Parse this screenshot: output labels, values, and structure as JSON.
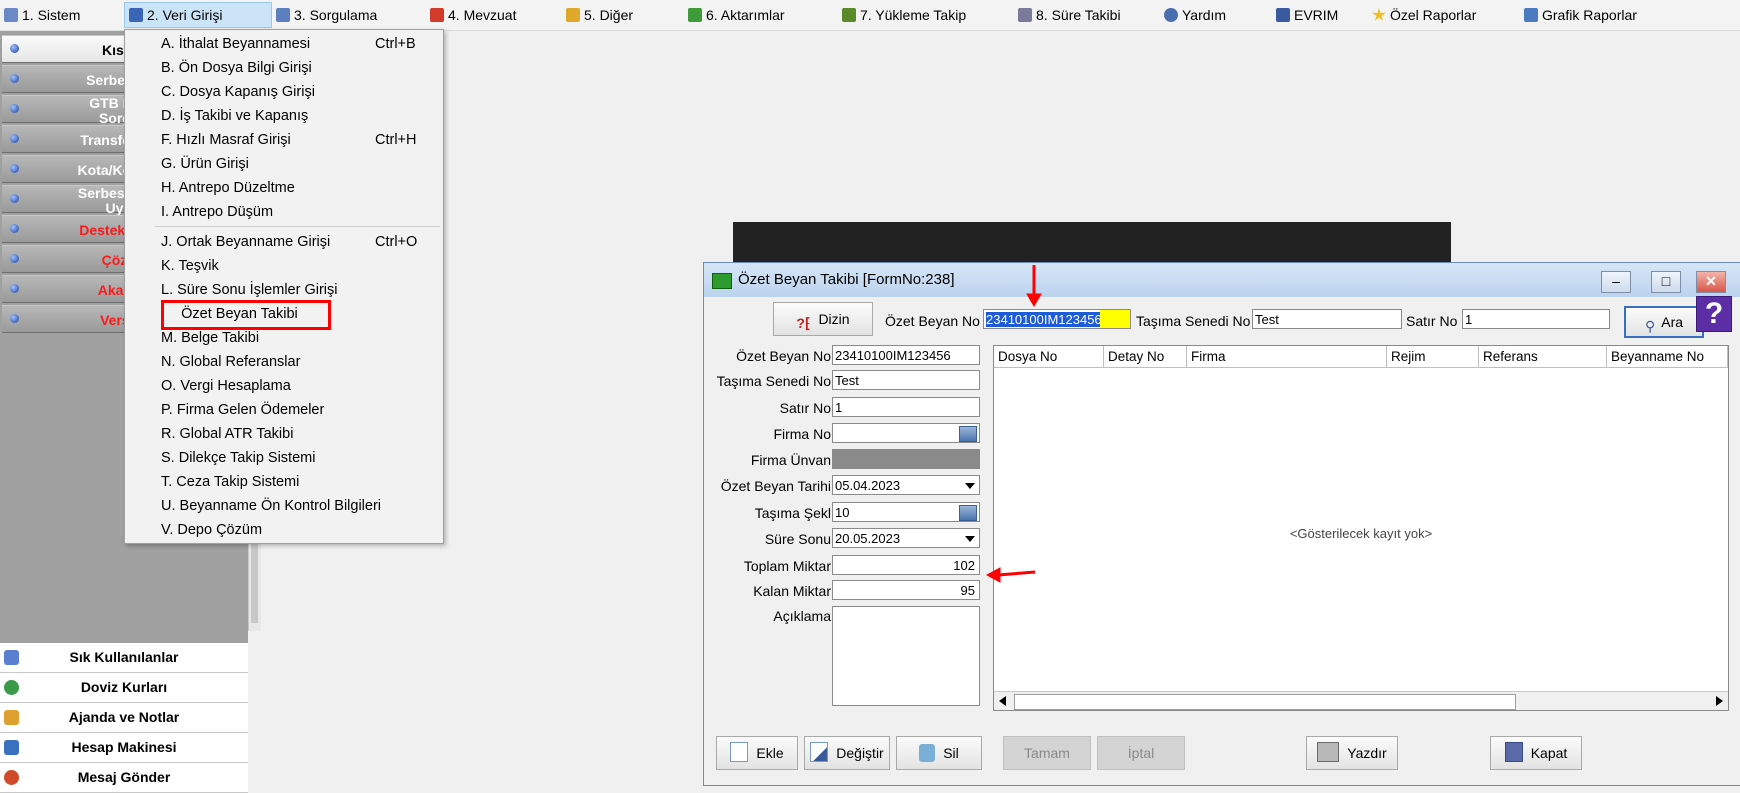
{
  "menubar": {
    "items": [
      {
        "label": "1.  Sistem"
      },
      {
        "label": "2.  Veri Girişi"
      },
      {
        "label": "3.  Sorgulama"
      },
      {
        "label": "4.  Mevzuat"
      },
      {
        "label": "5.  Diğer"
      },
      {
        "label": "6.  Aktarımlar"
      },
      {
        "label": "7.  Yükleme Takip"
      },
      {
        "label": "8. Süre Takibi"
      },
      {
        "label": "Yardım"
      },
      {
        "label": "EVRIM"
      },
      {
        "label": "Özel Raporlar"
      },
      {
        "label": "Grafik Raporlar"
      }
    ]
  },
  "sidebar": {
    "items": [
      {
        "label": "Kısayo"
      },
      {
        "label": "Serbest Böl"
      },
      {
        "label": "GTB DIR B\nSorgula"
      },
      {
        "label": "Transfer Bildi"
      },
      {
        "label": "Kota/Kontenja"
      },
      {
        "label": "Serbest Bölge\nUygul"
      },
      {
        "label": "Destek Videol"
      },
      {
        "label": "Çözüm"
      },
      {
        "label": "Akadem"
      },
      {
        "label": "Versiyo"
      }
    ],
    "bottom": [
      {
        "label": "Sık Kullanılanlar"
      },
      {
        "label": "Doviz Kurları"
      },
      {
        "label": "Ajanda ve Notlar"
      },
      {
        "label": "Hesap Makinesi"
      },
      {
        "label": "Mesaj Gönder"
      }
    ]
  },
  "dropdown": {
    "items": [
      {
        "label": "A.  İthalat Beyannamesi",
        "shortcut": "Ctrl+B"
      },
      {
        "label": "B.  Ön Dosya Bilgi Girişi",
        "shortcut": ""
      },
      {
        "label": "C.  Dosya Kapanış Girişi",
        "shortcut": ""
      },
      {
        "label": "D.  İş Takibi ve Kapanış",
        "shortcut": ""
      },
      {
        "label": "F.  Hızlı Masraf Girişi",
        "shortcut": "Ctrl+H"
      },
      {
        "label": "G.  Ürün Girişi",
        "shortcut": ""
      },
      {
        "label": "H.  Antrepo Düzeltme",
        "shortcut": ""
      },
      {
        "label": "I.  Antrepo Düşüm",
        "shortcut": ""
      },
      {
        "label": "J.  Ortak Beyanname Girişi",
        "shortcut": "Ctrl+O"
      },
      {
        "label": "K.  Teşvik",
        "shortcut": ""
      },
      {
        "label": "L.  Süre Sonu İşlemler Girişi",
        "shortcut": ""
      },
      {
        "label": "     Özet Beyan Takibi",
        "shortcut": ""
      },
      {
        "label": "M.  Belge Takibi",
        "shortcut": ""
      },
      {
        "label": "N.  Global Referanslar",
        "shortcut": ""
      },
      {
        "label": "O. Vergi Hesaplama",
        "shortcut": ""
      },
      {
        "label": "P. Firma Gelen Ödemeler",
        "shortcut": ""
      },
      {
        "label": "R. Global ATR Takibi",
        "shortcut": ""
      },
      {
        "label": "S. Dilekçe Takip Sistemi",
        "shortcut": ""
      },
      {
        "label": "T. Ceza Takip Sistemi",
        "shortcut": ""
      },
      {
        "label": "U. Beyanname Ön Kontrol Bilgileri",
        "shortcut": ""
      },
      {
        "label": "V. Depo Çözüm",
        "shortcut": ""
      }
    ]
  },
  "window": {
    "title": "Özet Beyan Takibi [FormNo:238]",
    "toolbar": {
      "dizin_label": "Dizin",
      "ozet_label": "Özet Beyan No",
      "ozet_value": "23410100IM123456",
      "tasima_label": "Taşıma Senedi No",
      "tasima_value": "Test",
      "satir_label": "Satır No",
      "satir_value": "1",
      "ara_label": "Ara"
    },
    "form": {
      "ozet_beyan_no": {
        "label": "Özet Beyan No",
        "value": "23410100IM123456"
      },
      "tasima_senedi_no": {
        "label": "Taşıma Senedi No",
        "value": "Test"
      },
      "satir_no": {
        "label": "Satır No",
        "value": "1"
      },
      "firma_no": {
        "label": "Firma No",
        "value": ""
      },
      "firma_unvan": {
        "label": "Firma Ünvan",
        "value": ""
      },
      "ozet_beyan_tarihi": {
        "label": "Özet Beyan Tarihi",
        "value": "05.04.2023"
      },
      "tasima_sekli": {
        "label": "Taşıma Şekl",
        "value": "10"
      },
      "sure_sonu": {
        "label": "Süre Sonu",
        "value": "20.05.2023"
      },
      "toplam_miktar": {
        "label": "Toplam Miktar",
        "value": "102"
      },
      "kalan_miktar": {
        "label": "Kalan Miktar",
        "value": "95"
      },
      "aciklama": {
        "label": "Açıklama",
        "value": ""
      }
    },
    "grid": {
      "columns": [
        "Dosya No",
        "Detay No",
        "Firma",
        "Rejim",
        "Referans",
        "Beyanname No"
      ],
      "empty_text": "<Gösterilecek kayıt yok>"
    },
    "buttons": {
      "ekle": "Ekle",
      "degistir": "Değiştir",
      "sil": "Sil",
      "tamam": "Tamam",
      "iptal": "İptal",
      "yazdir": "Yazdır",
      "kapat": "Kapat"
    },
    "help_glyph": "?"
  },
  "annotations": {
    "arrow_color": "#ff0000",
    "highlight_color": "#ff0000"
  }
}
